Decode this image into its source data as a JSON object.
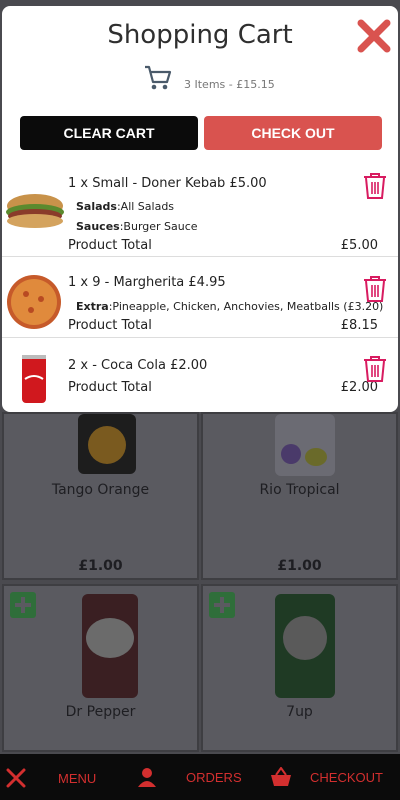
{
  "modal": {
    "title": "Shopping Cart",
    "summary": "3 Items - £15.15",
    "clear_label": "CLEAR CART",
    "checkout_label": "CHECK OUT",
    "items": [
      {
        "title": "1 x Small - Doner Kebab £5.00",
        "lines": [
          {
            "label": "Salads",
            "value": ":All Salads"
          },
          {
            "label": "Sauces",
            "value": ":Burger Sauce"
          }
        ],
        "total_label": "Product Total",
        "total": "£5.00"
      },
      {
        "title": "1 x 9 - Margherita £4.95",
        "lines": [
          {
            "label": "Extra",
            "value": ":Pineapple, Chicken, Anchovies, Meatballs (£3.20)"
          }
        ],
        "total_label": "Product Total",
        "total": "£8.15"
      },
      {
        "title": "2 x - Coca Cola £2.00",
        "lines": [],
        "total_label": "Product Total",
        "total": "£2.00"
      }
    ]
  },
  "products": [
    {
      "name": "Tango Orange",
      "price": "£1.00"
    },
    {
      "name": "Rio Tropical",
      "price": "£1.00"
    },
    {
      "name": "Dr Pepper",
      "price": ""
    },
    {
      "name": "7up",
      "price": ""
    }
  ],
  "nav": {
    "menu": "MENU",
    "orders": "ORDERS",
    "checkout": "CHECKOUT"
  },
  "colors": {
    "accent_red": "#d9534f",
    "nav_red": "#d32f2f",
    "trash_pink": "#d81b60",
    "add_green": "#2f6e3a"
  }
}
